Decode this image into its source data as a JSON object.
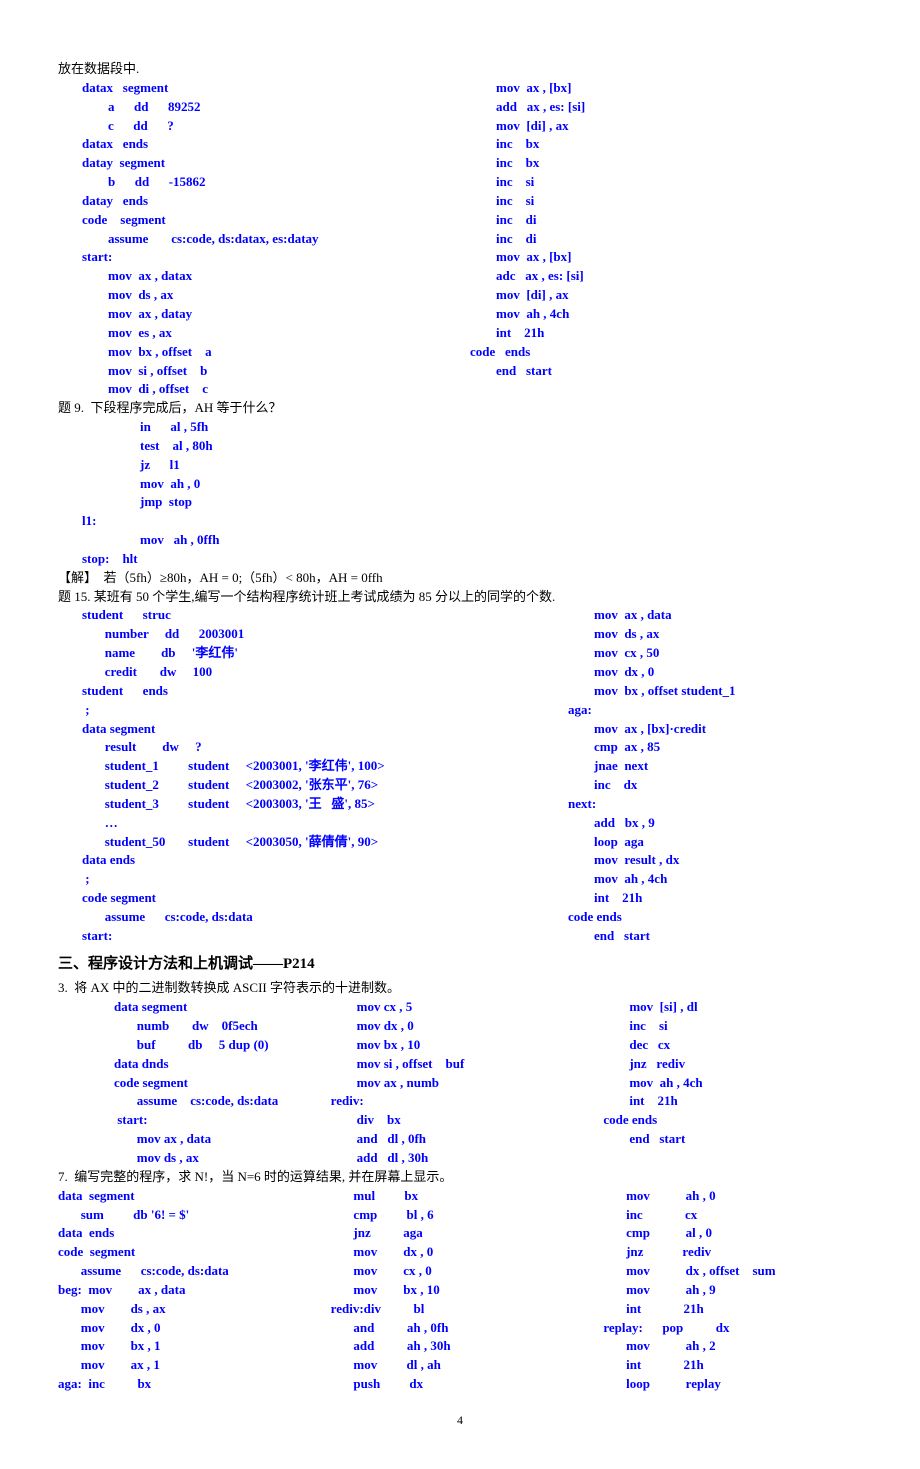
{
  "intro": "放在数据段中.",
  "block1_left": [
    "datax   segment",
    "        a      dd      89252",
    "        c      dd      ?",
    "datax   ends",
    "datay  segment",
    "        b      dd      -15862",
    "datay   ends",
    "code    segment",
    "        assume       cs:code, ds:datax, es:datay",
    "start:",
    "        mov  ax , datax",
    "        mov  ds , ax",
    "        mov  ax , datay",
    "        mov  es , ax",
    "        mov  bx , offset    a",
    "        mov  si , offset    b",
    "        mov  di , offset    c"
  ],
  "block1_right": [
    "        mov  ax , [bx]",
    "        add   ax , es: [si]",
    "        mov  [di] , ax",
    "        inc    bx",
    "        inc    bx",
    "        inc    si",
    "        inc    si",
    "        inc    di",
    "        inc    di",
    "        mov  ax , [bx]",
    "        adc   ax , es: [si]",
    "        mov  [di] , ax",
    "        mov  ah , 4ch",
    "        int    21h",
    "code   ends",
    "        end   start"
  ],
  "q9_title": "题 9.  下段程序完成后，AH 等于什么？",
  "q9_code": [
    "        in      al , 5fh",
    "        test    al , 80h",
    "        jz      l1",
    "        mov  ah , 0",
    "        jmp  stop",
    "l1:",
    "        mov   ah , 0ffh",
    "stop:    hlt"
  ],
  "q9_answer": "【解】  若（5fh）≥80h，AH = 0;（5fh）< 80h，AH = 0ffh",
  "q15_title": "题 15. 某班有 50 个学生,编写一个结构程序统计班上考试成绩为 85 分以上的同学的个数.",
  "q15_left": [
    "student      struc",
    "       number     dd      2003001",
    "       name        db     '李红伟'",
    "       credit       dw     100",
    "student      ends",
    " ;",
    "data segment",
    "       result        dw     ?",
    "       student_1         student     <2003001, '李红伟', 100>",
    "       student_2         student     <2003002, '张东平', 76>",
    "       student_3         student     <2003003, '王   盛', 85>",
    "       …",
    "       student_50       student     <2003050, '薛倩倩', 90>",
    "data ends",
    " ;",
    "code segment",
    "       assume      cs:code, ds:data",
    "start:"
  ],
  "q15_right": [
    "        mov  ax , data",
    "        mov  ds , ax",
    "        mov  cx , 50",
    "        mov  dx , 0",
    "        mov  bx , offset student_1",
    "aga:",
    "        mov  ax , [bx]·credit",
    "        cmp  ax , 85",
    "        jnae  next",
    "        inc    dx",
    "next:",
    "        add   bx , 9",
    "        loop  aga",
    "        mov  result , dx",
    "        mov  ah , 4ch",
    "        int    21h",
    "code ends",
    "        end   start"
  ],
  "section3": "三、程序设计方法和上机调试——P214",
  "p3_title": "3.  将 AX 中的二进制数转换成 ASCII 字符表示的十进制数。",
  "p3_col1": [
    "data segment",
    "       numb       dw    0f5ech",
    "       buf          db     5 dup (0)",
    "data dnds",
    "code segment",
    "       assume    cs:code, ds:data",
    " start:",
    "       mov ax , data",
    "       mov ds , ax"
  ],
  "p3_col2": [
    "        mov cx , 5",
    "        mov dx , 0",
    "        mov bx , 10",
    "        mov si , offset    buf",
    "        mov ax , numb",
    "rediv:",
    "        div    bx",
    "        and   dl , 0fh",
    "        add   dl , 30h"
  ],
  "p3_col3": [
    "        mov  [si] , dl",
    "        inc    si",
    "        dec   cx",
    "        jnz   rediv",
    "        mov  ah , 4ch",
    "        int    21h",
    "code ends",
    "        end   start"
  ],
  "p7_title": "7.  编写完整的程序，求 N!，当 N=6 时的运算结果, 并在屏幕上显示。",
  "p7_col1": [
    "data  segment",
    "       sum         db '6! = $'",
    "data  ends",
    "code  segment",
    "       assume      cs:code, ds:data",
    "beg:  mov        ax , data",
    "       mov        ds , ax",
    "       mov        dx , 0",
    "       mov        bx , 1",
    "       mov        ax , 1",
    "aga:  inc          bx"
  ],
  "p7_col2": [
    "       mul         bx",
    "       cmp         bl , 6",
    "       jnz          aga",
    "       mov        dx , 0",
    "       mov        cx , 0",
    "       mov        bx , 10",
    "rediv:div          bl",
    "       and          ah , 0fh",
    "       add          ah , 30h",
    "       mov         dl , ah",
    "       push         dx"
  ],
  "p7_col3": [
    "       mov           ah , 0",
    "       inc             cx",
    "       cmp           al , 0",
    "       jnz            rediv",
    "       mov           dx , offset    sum",
    "       mov           ah , 9",
    "       int             21h",
    "replay:      pop          dx",
    "       mov           ah , 2",
    "       int             21h",
    "       loop           replay"
  ],
  "pageno": "4"
}
